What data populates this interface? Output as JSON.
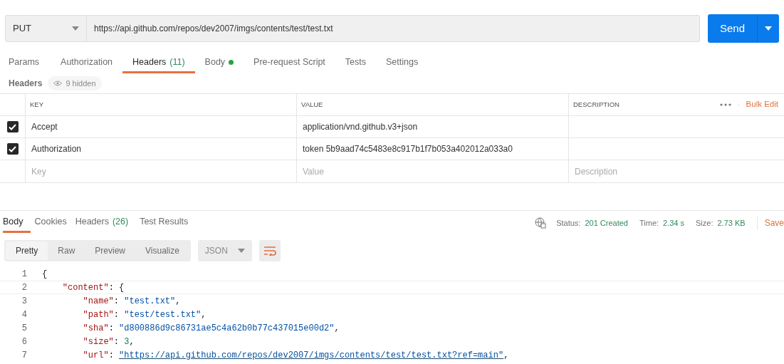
{
  "request": {
    "method": "PUT",
    "url": "https://api.github.com/repos/dev2007/imgs/contents/test/test.txt",
    "send_label": "Send"
  },
  "request_tabs": [
    {
      "label": "Params",
      "selected": false
    },
    {
      "label": "Authorization",
      "selected": false
    },
    {
      "label": "Headers",
      "count": "(11)",
      "selected": true
    },
    {
      "label": "Body",
      "dot": true,
      "selected": false
    },
    {
      "label": "Pre-request Script",
      "selected": false
    },
    {
      "label": "Tests",
      "selected": false
    },
    {
      "label": "Settings",
      "selected": false
    }
  ],
  "headers_bar": {
    "label": "Headers",
    "hidden": "9 hidden"
  },
  "headers_table": {
    "columns": [
      "KEY",
      "VALUE",
      "DESCRIPTION"
    ],
    "bulk_edit": "Bulk Edit",
    "rows": [
      {
        "checked": true,
        "key": "Accept",
        "value": "application/vnd.github.v3+json"
      },
      {
        "checked": true,
        "key": "Authorization",
        "value": "token 5b9aad74c5483e8c917b1f7b053a402012a033a0"
      }
    ],
    "new_row": {
      "key_placeholder": "Key",
      "value_placeholder": "Value",
      "description_placeholder": "Description"
    }
  },
  "response_tabs": [
    {
      "label": "Body",
      "selected": true
    },
    {
      "label": "Cookies",
      "selected": false
    },
    {
      "label": "Headers",
      "count": "(26)",
      "selected": false
    },
    {
      "label": "Test Results",
      "selected": false
    }
  ],
  "response_status": {
    "status_label": "Status:",
    "status": "201 Created",
    "time_label": "Time:",
    "time": "2.34 s",
    "size_label": "Size:",
    "size": "2.73 KB",
    "save": "Save"
  },
  "view_modes": [
    {
      "label": "Pretty",
      "selected": true
    },
    {
      "label": "Raw",
      "selected": false
    },
    {
      "label": "Preview",
      "selected": false
    },
    {
      "label": "Visualize",
      "selected": false
    }
  ],
  "format": "JSON",
  "code_lines": [
    {
      "number": "1",
      "tokens": [
        {
          "kind": "punct",
          "text": "{"
        }
      ]
    },
    {
      "number": "2",
      "tokens": [
        {
          "kind": "key",
          "text": "    \"content\""
        },
        {
          "kind": "punct",
          "text": ": {"
        }
      ]
    },
    {
      "number": "3",
      "tokens": [
        {
          "kind": "key",
          "text": "        \"name\""
        },
        {
          "kind": "punct",
          "text": ": "
        },
        {
          "kind": "string",
          "text": "\"test.txt\""
        },
        {
          "kind": "punct",
          "text": ","
        }
      ]
    },
    {
      "number": "4",
      "tokens": [
        {
          "kind": "key",
          "text": "        \"path\""
        },
        {
          "kind": "punct",
          "text": ": "
        },
        {
          "kind": "string",
          "text": "\"test/test.txt\""
        },
        {
          "kind": "punct",
          "text": ","
        }
      ]
    },
    {
      "number": "5",
      "tokens": [
        {
          "kind": "key",
          "text": "        \"sha\""
        },
        {
          "kind": "punct",
          "text": ": "
        },
        {
          "kind": "string",
          "text": "\"d800886d9c86731ae5c4a62b0b77c437015e00d2\""
        },
        {
          "kind": "punct",
          "text": ","
        }
      ]
    },
    {
      "number": "6",
      "tokens": [
        {
          "kind": "key",
          "text": "        \"size\""
        },
        {
          "kind": "punct",
          "text": ": "
        },
        {
          "kind": "number",
          "text": "3"
        },
        {
          "kind": "punct",
          "text": ","
        }
      ]
    },
    {
      "number": "7",
      "tokens": [
        {
          "kind": "key",
          "text": "        \"url\""
        },
        {
          "kind": "punct",
          "text": ": "
        },
        {
          "kind": "link",
          "text": "\"https://api.github.com/repos/dev2007/imgs/contents/test/test.txt?ref=main\""
        },
        {
          "kind": "punct",
          "text": ","
        }
      ]
    }
  ]
}
